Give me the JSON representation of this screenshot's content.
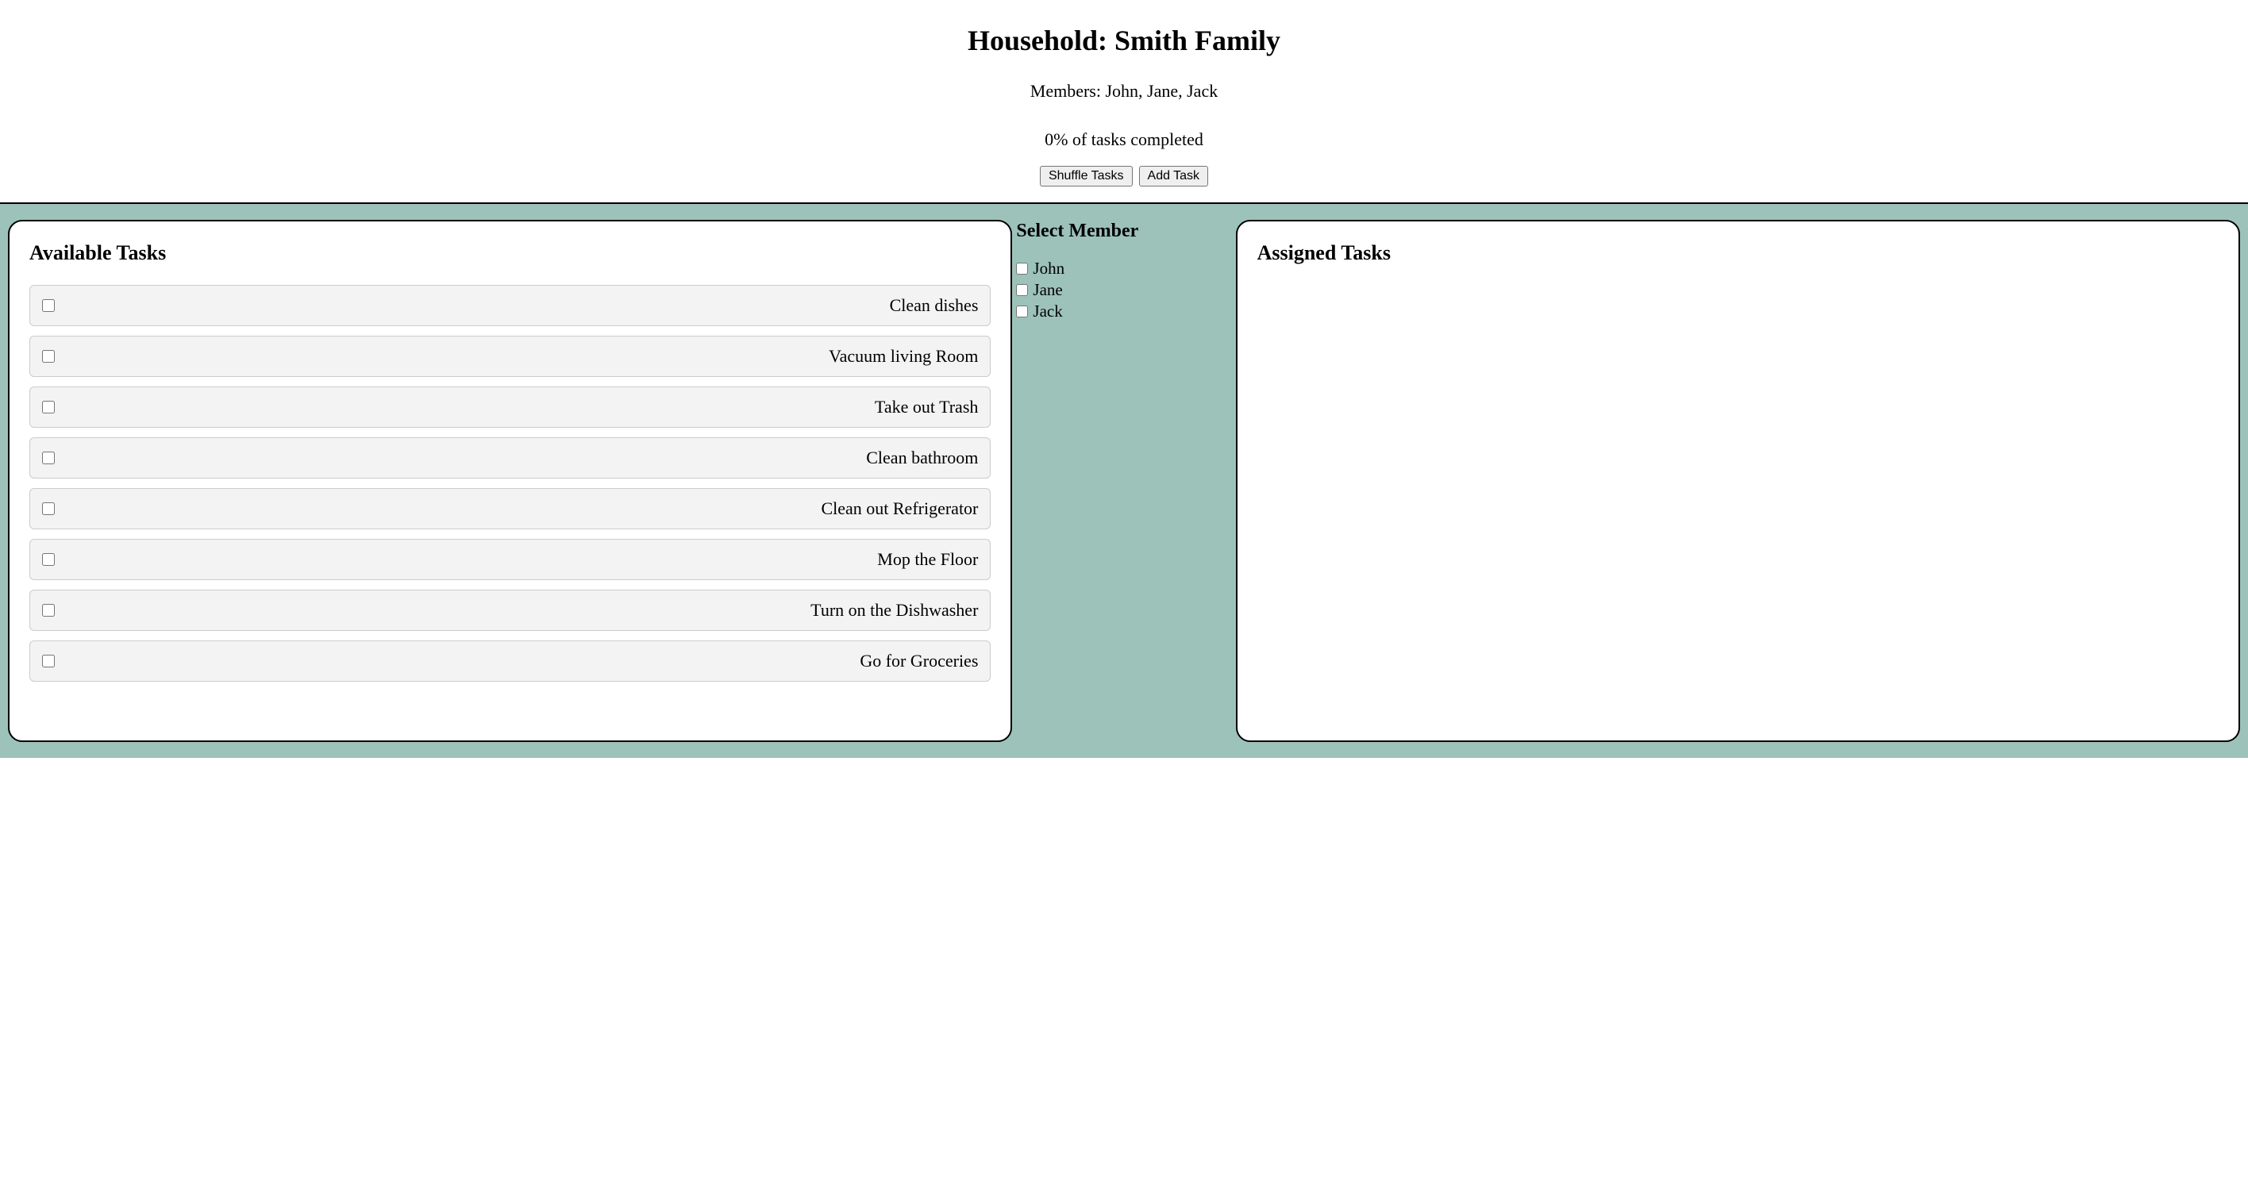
{
  "header": {
    "title": "Household: Smith Family",
    "members_line": "Members: John, Jane, Jack",
    "progress_line": "0% of tasks completed",
    "shuffle_button": "Shuffle Tasks",
    "add_button": "Add Task"
  },
  "available_panel": {
    "title": "Available Tasks",
    "tasks": [
      "Clean dishes",
      "Vacuum living Room",
      "Take out Trash",
      "Clean bathroom",
      "Clean out Refrigerator",
      "Mop the Floor",
      "Turn on the Dishwasher",
      "Go for Groceries"
    ]
  },
  "member_select": {
    "title": "Select Member",
    "members": [
      "John",
      "Jane",
      "Jack"
    ]
  },
  "assigned_panel": {
    "title": "Assigned Tasks"
  }
}
